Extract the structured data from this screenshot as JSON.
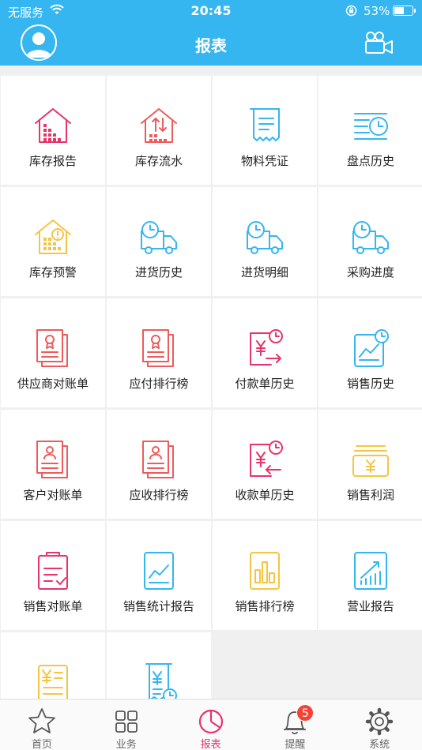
{
  "status_bar": {
    "carrier": "无服务",
    "time": "20:45",
    "battery": "53%"
  },
  "header": {
    "title": "报表"
  },
  "reports": [
    {
      "label": "库存报告",
      "icon": "warehouse-chart-icon",
      "color": "#e8336b"
    },
    {
      "label": "库存流水",
      "icon": "warehouse-flow-icon",
      "color": "#f05a5a"
    },
    {
      "label": "物料凭证",
      "icon": "receipt-icon",
      "color": "#35b6f0"
    },
    {
      "label": "盘点历史",
      "icon": "list-clock-icon",
      "color": "#35b6f0"
    },
    {
      "label": "库存预警",
      "icon": "warehouse-warning-icon",
      "color": "#f5c542"
    },
    {
      "label": "进货历史",
      "icon": "truck-clock-icon",
      "color": "#35b6f0"
    },
    {
      "label": "进货明细",
      "icon": "truck-clock-icon",
      "color": "#35b6f0"
    },
    {
      "label": "采购进度",
      "icon": "truck-clock-icon",
      "color": "#35b6f0"
    },
    {
      "label": "供应商对账单",
      "icon": "certificate-doc-icon",
      "color": "#f05a5a"
    },
    {
      "label": "应付排行榜",
      "icon": "certificate-doc-icon",
      "color": "#f05a5a"
    },
    {
      "label": "付款单历史",
      "icon": "yuan-doc-out-icon",
      "color": "#e8336b"
    },
    {
      "label": "销售历史",
      "icon": "sales-trend-clock-icon",
      "color": "#35b6f0"
    },
    {
      "label": "客户对账单",
      "icon": "person-doc-icon",
      "color": "#f05a5a"
    },
    {
      "label": "应收排行榜",
      "icon": "person-doc-icon",
      "color": "#f05a5a"
    },
    {
      "label": "收款单历史",
      "icon": "yuan-doc-in-icon",
      "color": "#e8336b"
    },
    {
      "label": "销售利润",
      "icon": "money-stack-icon",
      "color": "#f5c542"
    },
    {
      "label": "销售对账单",
      "icon": "clipboard-check-icon",
      "color": "#e8336b"
    },
    {
      "label": "销售统计报告",
      "icon": "line-chart-doc-icon",
      "color": "#35b6f0"
    },
    {
      "label": "销售排行榜",
      "icon": "bar-chart-doc-icon",
      "color": "#f5c542"
    },
    {
      "label": "营业报告",
      "icon": "growth-chart-icon",
      "color": "#35b6f0"
    },
    {
      "label": "",
      "icon": "yuan-list-icon",
      "color": "#f5c542"
    },
    {
      "label": "",
      "icon": "yuan-receipt-clock-icon",
      "color": "#35b6f0"
    }
  ],
  "tabs": [
    {
      "label": "首页",
      "icon": "star-icon",
      "active": false
    },
    {
      "label": "业务",
      "icon": "grid-icon",
      "active": false
    },
    {
      "label": "报表",
      "icon": "pie-chart-icon",
      "active": true
    },
    {
      "label": "提醒",
      "icon": "bell-icon",
      "active": false,
      "badge": "5"
    },
    {
      "label": "系统",
      "icon": "gear-icon",
      "active": false
    }
  ]
}
